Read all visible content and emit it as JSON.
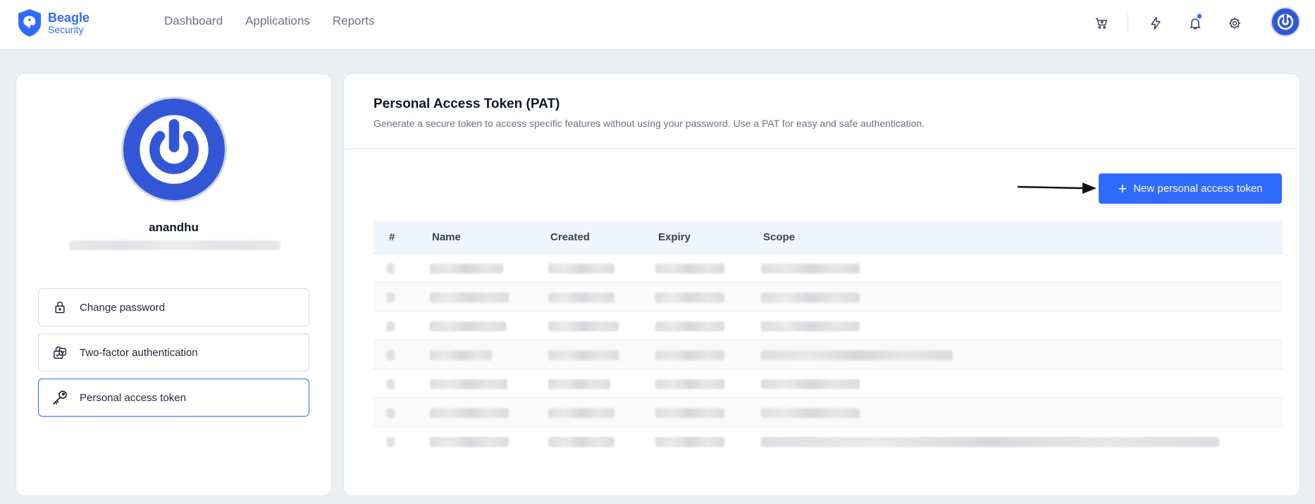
{
  "app": {
    "logo_line1": "Beagle",
    "logo_line2": "Security",
    "brand_color": "#2f6bff"
  },
  "nav": {
    "items": [
      {
        "label": "Dashboard"
      },
      {
        "label": "Applications"
      },
      {
        "label": "Reports"
      }
    ]
  },
  "top_icons": [
    "cart-icon",
    "lightning-icon",
    "bell-icon",
    "gear-icon",
    "user-avatar"
  ],
  "profile": {
    "username": "anandhu",
    "email_redacted": true
  },
  "sidebar": {
    "items": [
      {
        "label": "Change password",
        "icon": "lock-icon",
        "active": false
      },
      {
        "label": "Two-factor authentication",
        "icon": "two-factor-icon",
        "active": false
      },
      {
        "label": "Personal access token",
        "icon": "key-icon",
        "active": true
      }
    ]
  },
  "main": {
    "title": "Personal Access Token (PAT)",
    "subtitle": "Generate a secure token to access specific features without using your password. Use a PAT for easy and safe authentication.",
    "new_button_label": "New personal access token",
    "table": {
      "columns": [
        "#",
        "Name",
        "Created",
        "Expiry",
        "Scope"
      ],
      "row_count": 7,
      "rows_redacted": true
    }
  }
}
